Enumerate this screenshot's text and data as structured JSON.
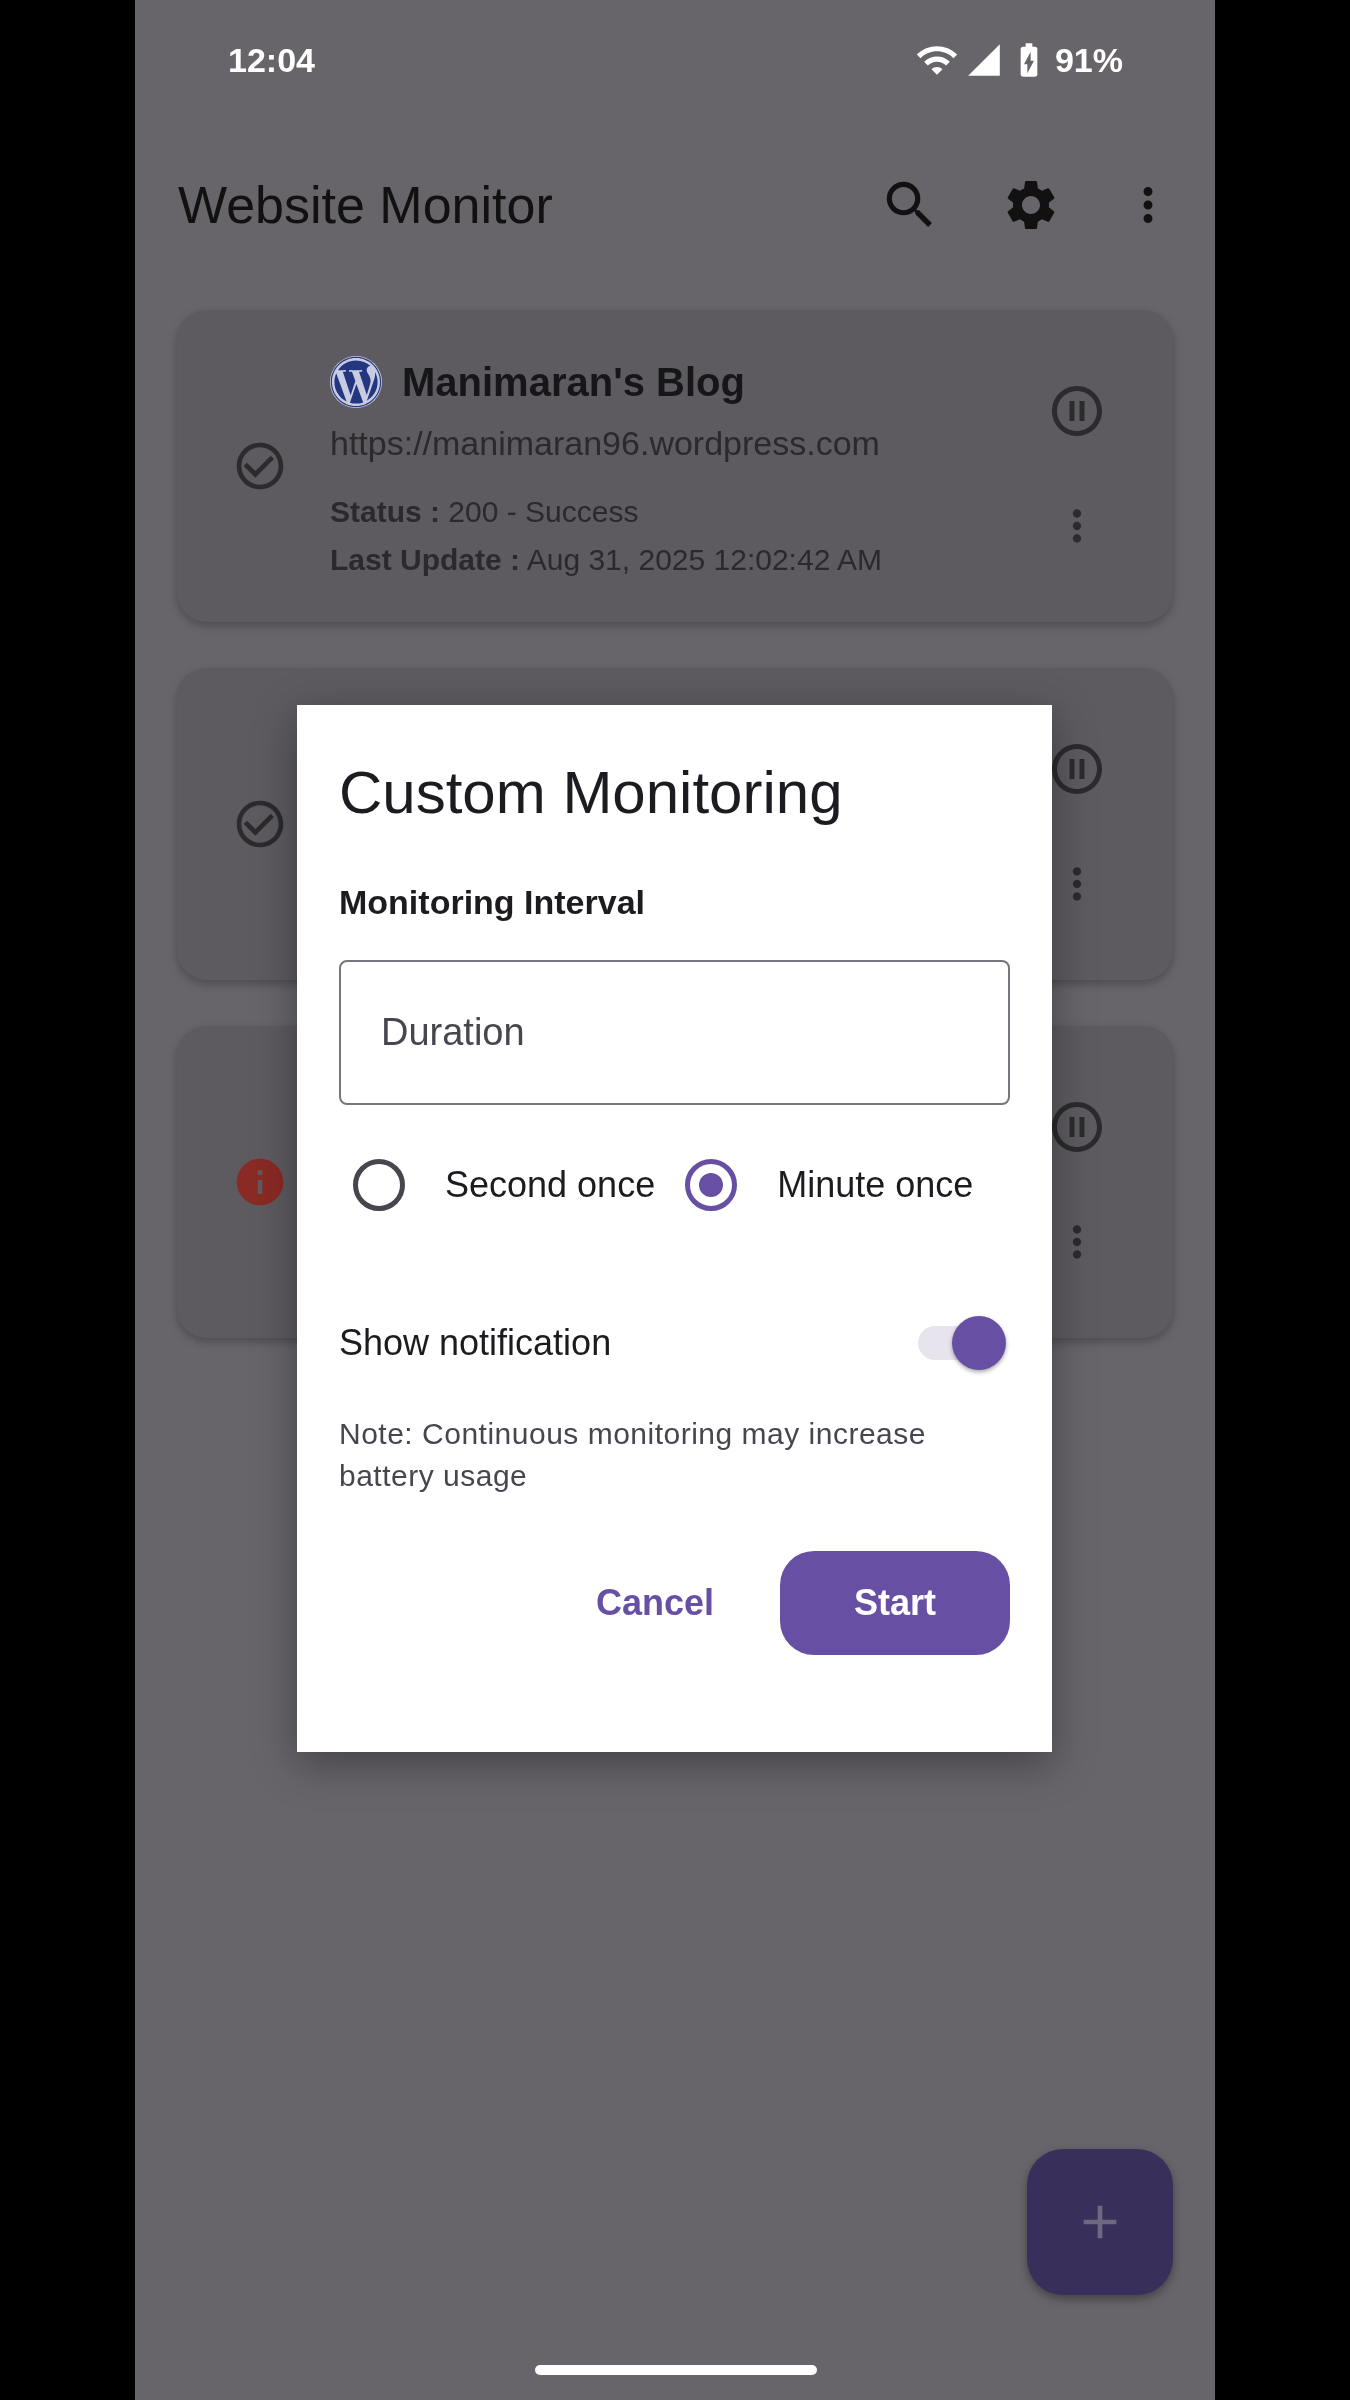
{
  "status_bar": {
    "time": "12:04",
    "battery": "91%"
  },
  "app_bar": {
    "title": "Website Monitor"
  },
  "cards": [
    {
      "kind": "ok",
      "title": "Manimaran's Blog",
      "url": "https://manimaran96.wordpress.com",
      "status_line": "**Status :** 200 - Success",
      "update_line": "**Last Update :** Aug 31, 2025 12:02:42 AM"
    },
    {
      "kind": "ok"
    },
    {
      "kind": "error"
    }
  ],
  "dialog": {
    "title": "Custom Monitoring",
    "section_label": "Monitoring Interval",
    "duration_field": {
      "placeholder": "Duration"
    },
    "interval_options": [
      {
        "label": "Second once",
        "selected": false
      },
      {
        "label": "Minute once",
        "selected": true
      }
    ],
    "notification": {
      "label": "Show notification",
      "on": true
    },
    "note": "Note: Continuous monitoring may increase battery usage",
    "buttons": [
      {
        "kind": "text",
        "label": "Cancel"
      },
      {
        "kind": "filled",
        "label": "Start"
      }
    ]
  }
}
